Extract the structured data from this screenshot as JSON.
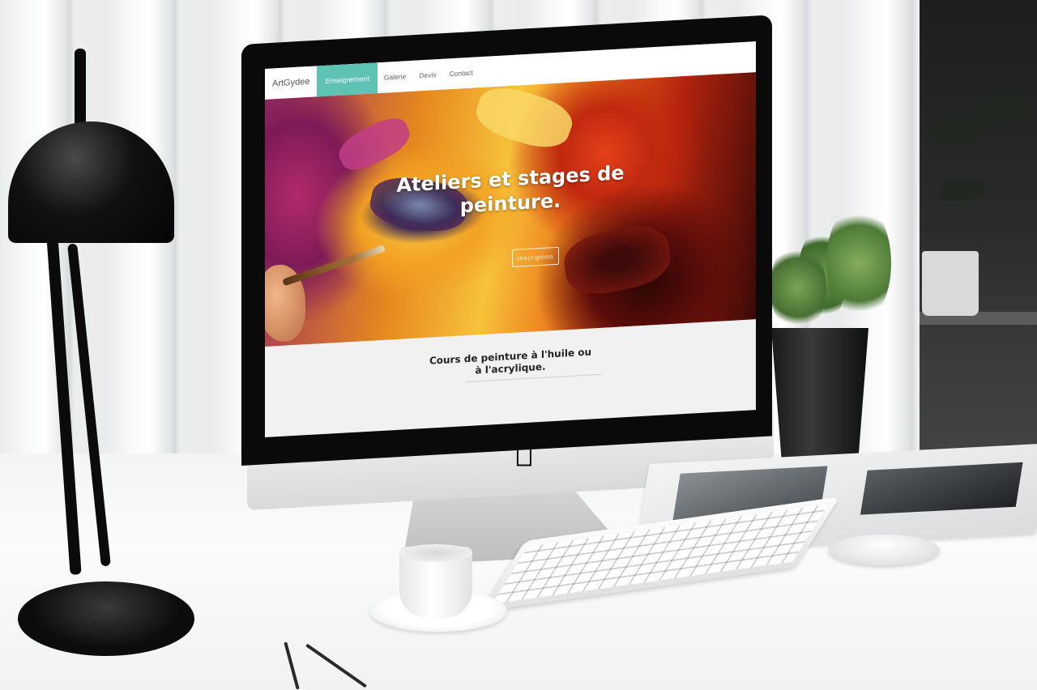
{
  "site": {
    "brand": "ArtGydee",
    "nav": [
      {
        "label": "Enseignement",
        "active": true
      },
      {
        "label": "Galerie",
        "active": false
      },
      {
        "label": "Devis",
        "active": false
      },
      {
        "label": "Contact",
        "active": false
      }
    ],
    "hero": {
      "title_line1": "Ateliers et stages de",
      "title_line2": "peinture.",
      "button": "inscription"
    },
    "section": {
      "title_line1": "Cours de peinture à l'huile ou",
      "title_line2": "à l'acrylique."
    }
  },
  "colors": {
    "accent": "#5ec3b3",
    "nav_bg": "#ffffff",
    "section_bg": "#f1f1f1"
  },
  "icons": [
    "apple-logo-icon"
  ]
}
